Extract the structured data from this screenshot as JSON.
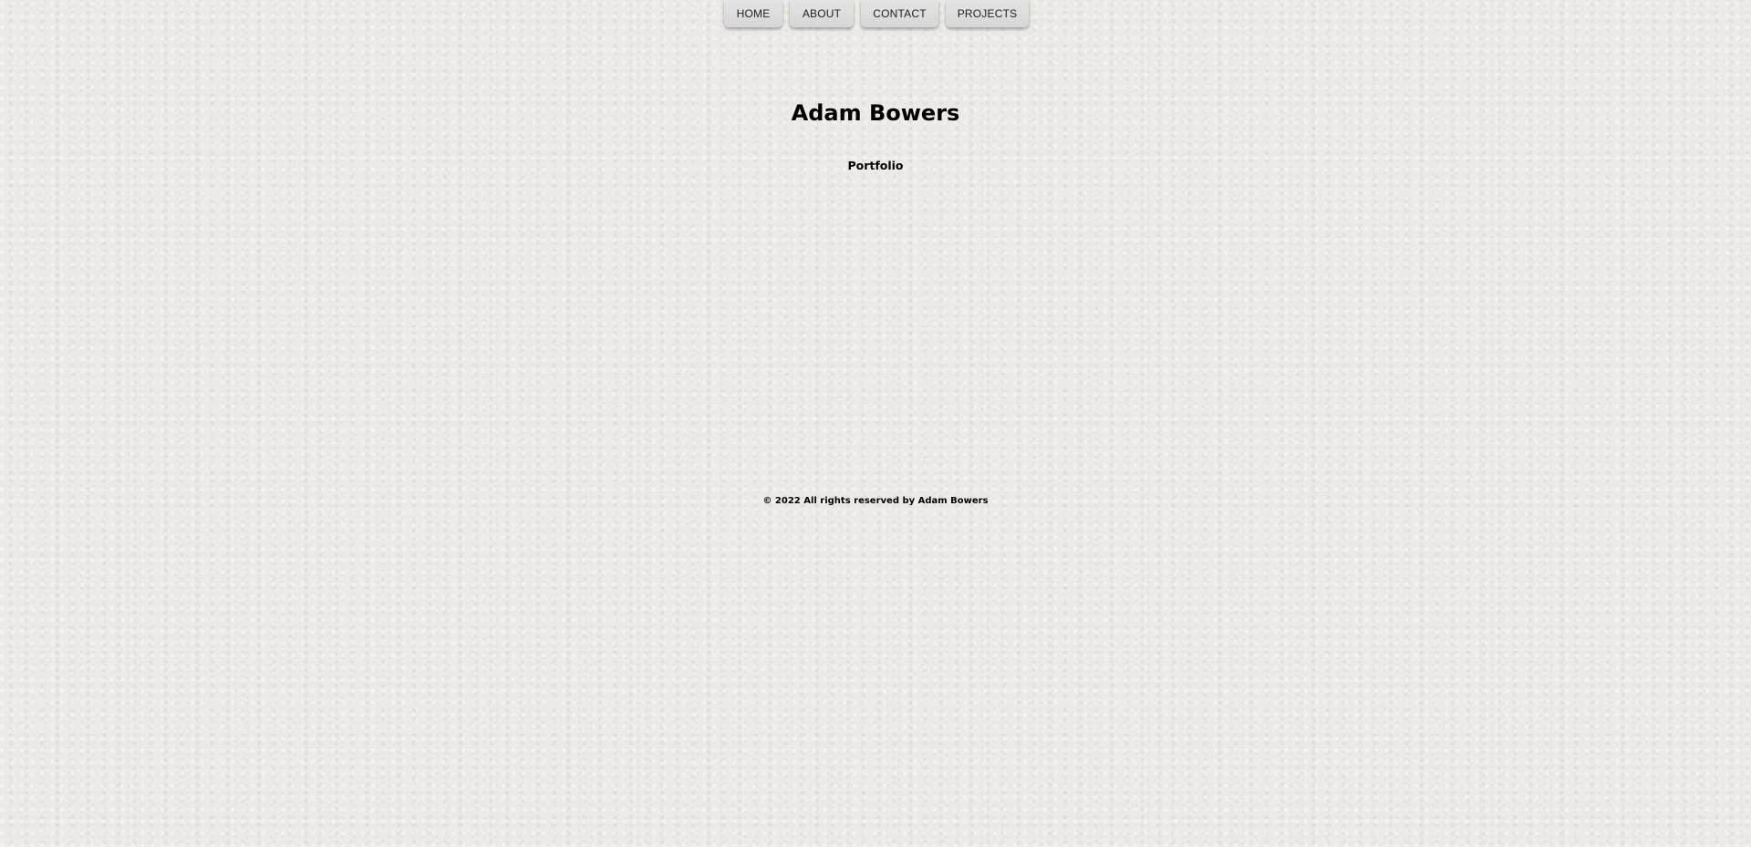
{
  "nav": {
    "items": [
      {
        "label": "HOME"
      },
      {
        "label": "ABOUT"
      },
      {
        "label": "CONTACT"
      },
      {
        "label": "PROJECTS"
      }
    ]
  },
  "header": {
    "title": "Adam Bowers",
    "subtitle": "Portfolio"
  },
  "footer": {
    "text": "© 2022 All rights reserved by Adam Bowers"
  },
  "colors": {
    "background": "#eceae6",
    "button": "#dddddd",
    "text": "#000000"
  }
}
